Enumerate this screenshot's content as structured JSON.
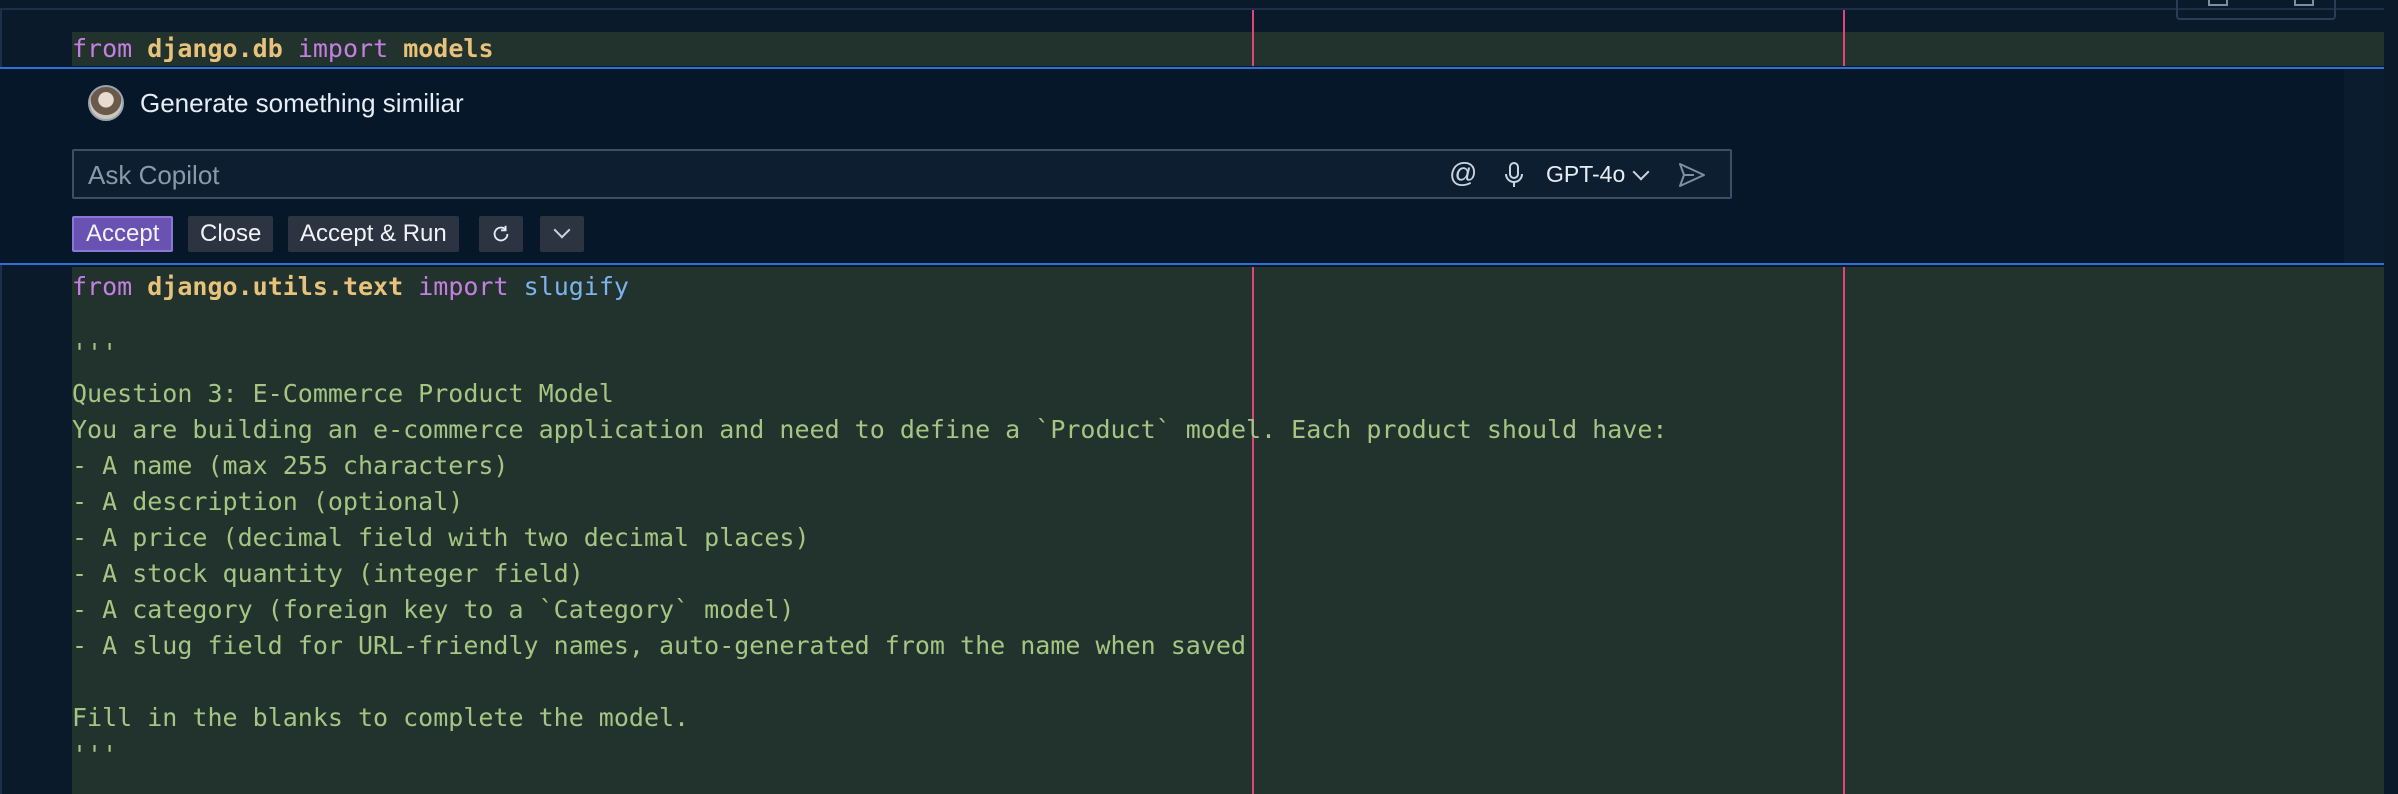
{
  "code": {
    "top_line": {
      "kw1": "from",
      "module": "django.db",
      "kw2": "import",
      "name": "models"
    },
    "import_line": {
      "kw1": "from",
      "module": "django.utils.text",
      "kw2": "import",
      "name": "slugify"
    },
    "doc": [
      "'''",
      "Question 3: E-Commerce Product Model  ",
      "You are building an e-commerce application and need to define a `Product` model. Each product should have:",
      "- A name (max 255 characters)",
      "- A description (optional)",
      "- A price (decimal field with two decimal places)",
      "- A stock quantity (integer field)",
      "- A category (foreign key to a `Category` model)",
      "- A slug field for URL-friendly names, auto-generated from the name when saved",
      "",
      "Fill in the blanks to complete the model.",
      "'''"
    ]
  },
  "chat": {
    "prompt": "Generate something similiar",
    "input_placeholder": "Ask Copilot",
    "model": "GPT-4o",
    "buttons": {
      "accept": "Accept",
      "close": "Close",
      "accept_run": "Accept & Run"
    },
    "icons": [
      "avatar",
      "at-sign-icon",
      "microphone-icon",
      "chevron-down-icon",
      "send-icon",
      "refresh-icon"
    ]
  },
  "colors": {
    "background": "#0b1a2a",
    "code_band": "#22332d",
    "string": "#a7c483",
    "keyword": "#c67ee3",
    "module": "#e8c27a",
    "function": "#7db3ee",
    "ruler": "#e0447a",
    "panel_border": "#2f6fd9",
    "accept_button": "#6a52b3"
  }
}
